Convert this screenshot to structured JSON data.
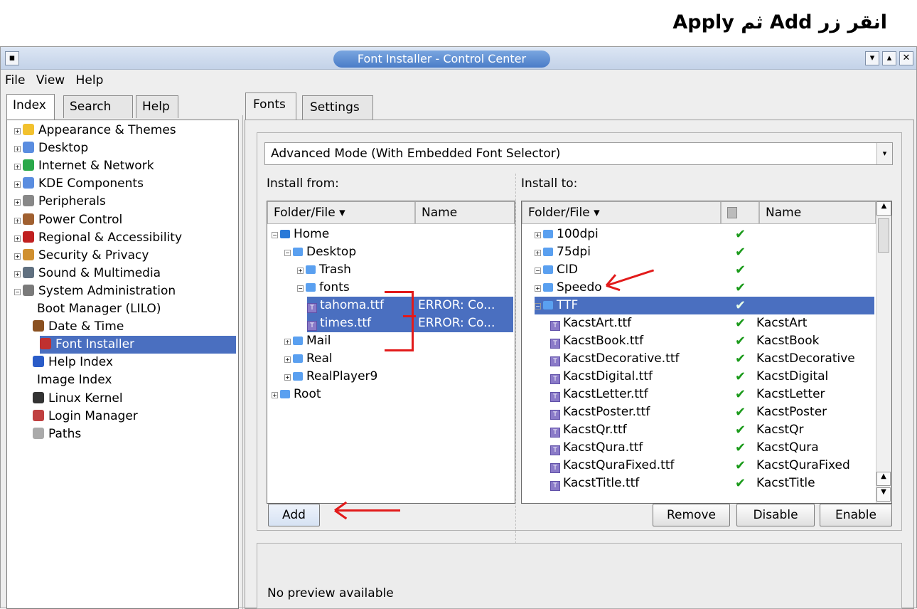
{
  "caption": "انقر زر Add ثم Apply",
  "window": {
    "title": "Font Installer - Control Center",
    "menu": [
      "File",
      "View",
      "Help"
    ]
  },
  "left_tabs": [
    "Index",
    "Search",
    "Help"
  ],
  "left_tree": [
    {
      "label": "Appearance & Themes",
      "icon": "appearance-star-icon"
    },
    {
      "label": "Desktop",
      "icon": "desktop-icon"
    },
    {
      "label": "Internet & Network",
      "icon": "network-globe-icon"
    },
    {
      "label": "KDE Components",
      "icon": "kde-components-icon"
    },
    {
      "label": "Peripherals",
      "icon": "peripherals-mouse-icon"
    },
    {
      "label": "Power Control",
      "icon": "power-control-icon"
    },
    {
      "label": "Regional & Accessibility",
      "icon": "regional-flag-icon"
    },
    {
      "label": "Security & Privacy",
      "icon": "security-hourglass-icon"
    },
    {
      "label": "Sound & Multimedia",
      "icon": "sound-speaker-icon"
    },
    {
      "label": "System Administration",
      "icon": "system-gear-icon"
    },
    {
      "label": "Boot Manager (LILO)",
      "icon": ""
    },
    {
      "label": "Date & Time",
      "icon": "calendar-icon"
    },
    {
      "label": "Font Installer",
      "icon": "font-installer-icon"
    },
    {
      "label": "Help Index",
      "icon": "help-question-icon"
    },
    {
      "label": "Image Index",
      "icon": ""
    },
    {
      "label": "Linux Kernel",
      "icon": "tux-penguin-icon"
    },
    {
      "label": "Login Manager",
      "icon": "login-manager-icon"
    },
    {
      "label": "Paths",
      "icon": "paths-icon"
    }
  ],
  "right_tabs": [
    "Fonts",
    "Settings"
  ],
  "mode_select": "Advanced Mode (With Embedded Font Selector)",
  "install_from": {
    "label": "Install from:",
    "headers": [
      "Folder/File",
      "Name"
    ],
    "rows": [
      {
        "label": "Home",
        "name": ""
      },
      {
        "label": "Desktop",
        "name": ""
      },
      {
        "label": "Trash",
        "name": ""
      },
      {
        "label": "fonts",
        "name": ""
      },
      {
        "label": "tahoma.ttf",
        "name": "ERROR: Co..."
      },
      {
        "label": "times.ttf",
        "name": "ERROR: Co..."
      },
      {
        "label": "Mail",
        "name": ""
      },
      {
        "label": "Real",
        "name": ""
      },
      {
        "label": "RealPlayer9",
        "name": ""
      },
      {
        "label": "Root",
        "name": ""
      }
    ]
  },
  "install_to": {
    "label": "Install to:",
    "headers": [
      "Folder/File",
      "Name"
    ],
    "rows": [
      {
        "label": "100dpi",
        "name": ""
      },
      {
        "label": "75dpi",
        "name": ""
      },
      {
        "label": "CID",
        "name": ""
      },
      {
        "label": "Speedo",
        "name": ""
      },
      {
        "label": "TTF",
        "name": ""
      },
      {
        "label": "KacstArt.ttf",
        "name": "KacstArt"
      },
      {
        "label": "KacstBook.ttf",
        "name": "KacstBook"
      },
      {
        "label": "KacstDecorative.ttf",
        "name": "KacstDecorative"
      },
      {
        "label": "KacstDigital.ttf",
        "name": "KacstDigital"
      },
      {
        "label": "KacstLetter.ttf",
        "name": "KacstLetter"
      },
      {
        "label": "KacstPoster.ttf",
        "name": "KacstPoster"
      },
      {
        "label": "KacstQr.ttf",
        "name": "KacstQr"
      },
      {
        "label": "KacstQura.ttf",
        "name": "KacstQura"
      },
      {
        "label": "KacstQuraFixed.ttf",
        "name": "KacstQuraFixed"
      },
      {
        "label": "KacstTitle.ttf",
        "name": "KacstTitle"
      }
    ]
  },
  "buttons": {
    "add": "Add",
    "remove": "Remove",
    "disable": "Disable",
    "enable": "Enable"
  },
  "preview_text": "No preview available",
  "colors": {
    "selection": "#4a6fc0",
    "annotation": "#e21a1a",
    "check": "#1a9a1a"
  }
}
